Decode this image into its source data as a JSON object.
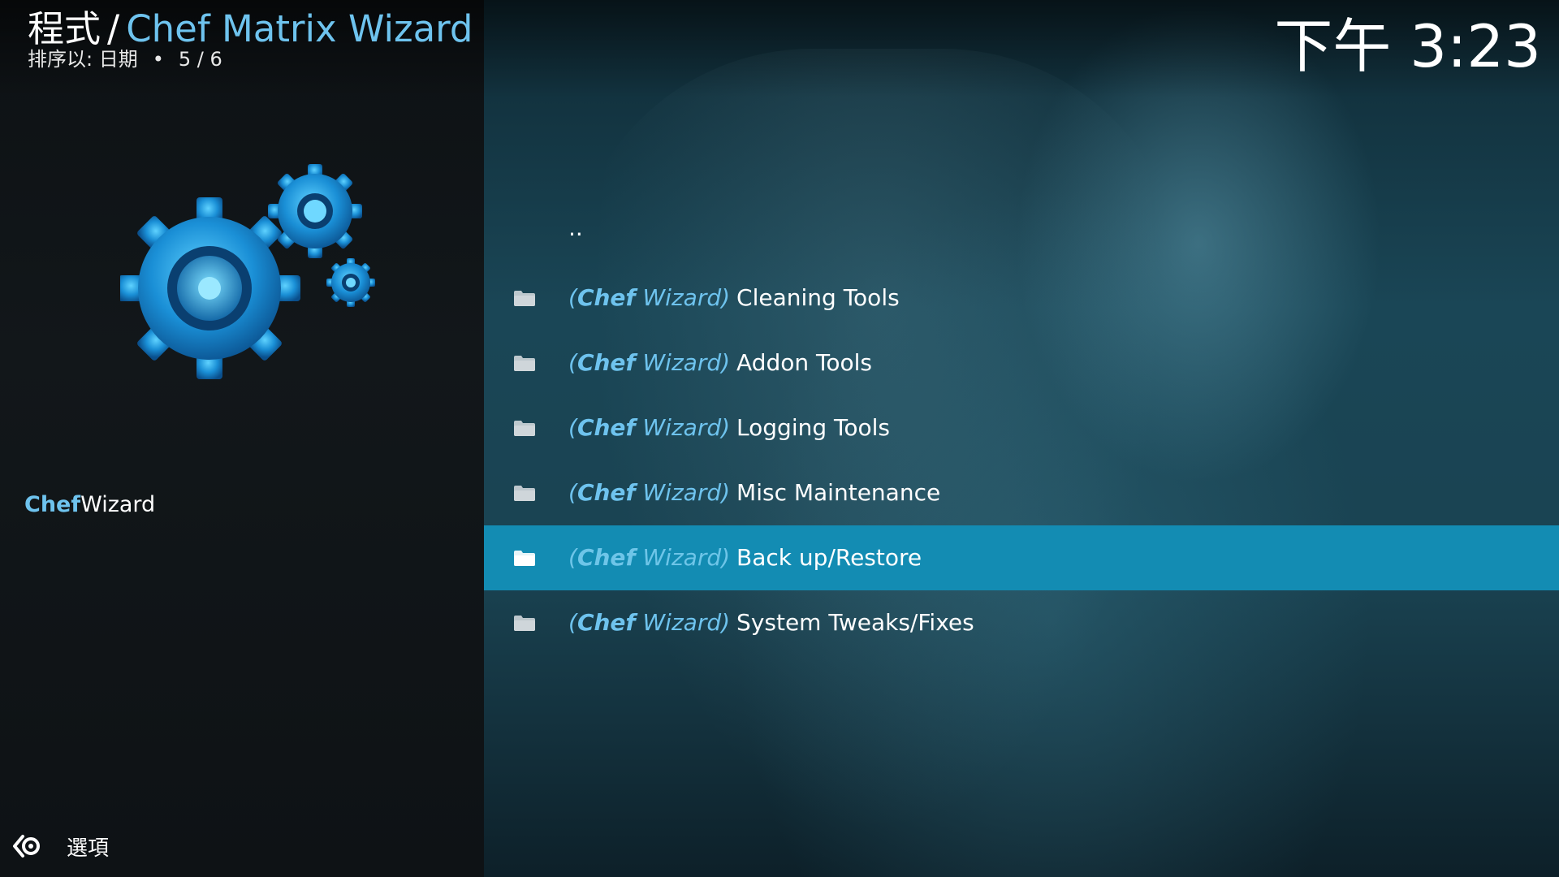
{
  "header": {
    "breadcrumb_root": "程式",
    "breadcrumb_separator": "/",
    "breadcrumb_current": "Chef Matrix Wizard",
    "sort_label": "排序以: 日期",
    "bullet": "•",
    "position": "5 / 6"
  },
  "clock": "下午 3:23",
  "addon": {
    "name_accent": "Chef",
    "name_rest": "Wizard",
    "icon": "gears-icon"
  },
  "options": {
    "label": "選項",
    "icon": "options-icon"
  },
  "list": {
    "parent": "..",
    "items": [
      {
        "prefix_chef": "Chef",
        "prefix_rest": " Wizard",
        "label": "Cleaning Tools",
        "icon": "folder-icon",
        "selected": false
      },
      {
        "prefix_chef": "Chef",
        "prefix_rest": " Wizard",
        "label": "Addon Tools",
        "icon": "folder-icon",
        "selected": false
      },
      {
        "prefix_chef": "Chef",
        "prefix_rest": " Wizard",
        "label": "Logging Tools",
        "icon": "folder-icon",
        "selected": false
      },
      {
        "prefix_chef": "Chef",
        "prefix_rest": " Wizard",
        "label": "Misc Maintenance",
        "icon": "folder-icon",
        "selected": false
      },
      {
        "prefix_chef": "Chef",
        "prefix_rest": " Wizard",
        "label": "Back up/Restore",
        "icon": "folder-icon",
        "selected": true
      },
      {
        "prefix_chef": "Chef",
        "prefix_rest": " Wizard",
        "label": "System Tweaks/Fixes",
        "icon": "folder-icon",
        "selected": false
      }
    ]
  },
  "colors": {
    "accent": "#6ec3ee",
    "selection": "#138cb3"
  }
}
